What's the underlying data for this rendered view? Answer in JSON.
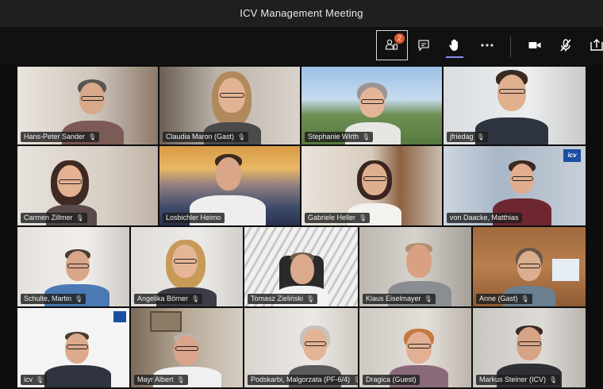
{
  "window": {
    "title": "ICV Management Meeting"
  },
  "toolbar": {
    "participants_badge": "2",
    "buttons": [
      "participants-icon",
      "chat-icon",
      "raise-hand-icon",
      "more-icon",
      "camera-icon",
      "mic-off-icon",
      "share-icon"
    ]
  },
  "participants": [
    {
      "name": "Hans-Peter Sander"
    },
    {
      "name": "Claudia Maron (Gast)"
    },
    {
      "name": "Stephanie Wirth"
    },
    {
      "name": "jfriedag"
    },
    {
      "name": "Carmen Zillmer"
    },
    {
      "name": "Losbichler Heimo"
    },
    {
      "name": "Gabriele Heller"
    },
    {
      "name": "von Daacke, Matthias"
    },
    {
      "name": "Schulte, Martin"
    },
    {
      "name": "Angelika Börner"
    },
    {
      "name": "Tomasz Zieliński"
    },
    {
      "name": "Klaus Eiselmayer"
    },
    {
      "name": "Anne (Gast)"
    },
    {
      "name": "icv"
    },
    {
      "name": "Mayr Albert"
    },
    {
      "name": "Podskarbi, Malgorzata (PF-6/4)"
    },
    {
      "name": "Dragica (Guest)"
    },
    {
      "name": "Markus Steiner (ICV)"
    }
  ],
  "logo_text": "icv",
  "colors": {
    "accent": "#8b8cf0",
    "badge": "#e0582b",
    "background": "#161616"
  }
}
